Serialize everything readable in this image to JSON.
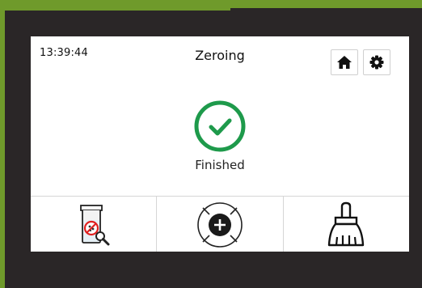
{
  "header": {
    "time": "13:39:44",
    "title": "Zeroing"
  },
  "status": {
    "text": "Finished",
    "color": "#1e9a4b"
  },
  "buttons": {
    "home_icon": "home-icon",
    "settings_icon": "gear-icon"
  },
  "toolbar": {
    "items": [
      {
        "icon": "no-sample-search-icon"
      },
      {
        "icon": "add-target-icon"
      },
      {
        "icon": "clean-brush-icon"
      }
    ]
  }
}
